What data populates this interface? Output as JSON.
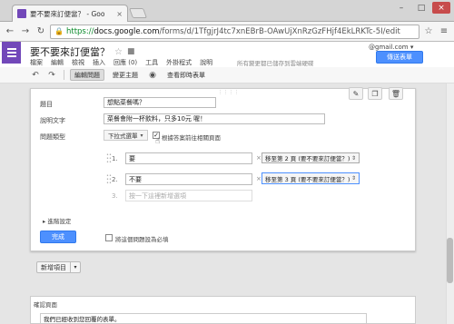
{
  "browser": {
    "tab_title": "要不要來訂便當？ - Goo",
    "tab_close": "×",
    "user": " ",
    "win_min": "–",
    "win_max": "□",
    "win_close": "×",
    "url_scheme": "https://",
    "url_host": "docs.google.com",
    "url_path": "/forms/d/1TfgjrJ4tc7xnEBrB-OAwUjXnRzGzFHjf4EkLRKTc-5I/edit"
  },
  "app": {
    "doc_title": "要不要來訂便當？",
    "account": "@gmail.com ▾",
    "share_label": "傳送表單",
    "saved_status": "所有變更都已儲存到雲端硬碟",
    "menu": [
      "檔案",
      "編輯",
      "檢視",
      "插入",
      "回應 (0)",
      "工具",
      "外掛程式",
      "說明"
    ]
  },
  "toolbar": {
    "edit_questions": "編輯問題",
    "change_theme": "變更主題",
    "view_live": "查看即時表單"
  },
  "question": {
    "title_label": "題目",
    "title_value": "想點菜餐嗎？",
    "help_label": "說明文字",
    "help_value": "菜餐會附一杯飲料，只多10元 喔！",
    "type_label": "問題類型",
    "type_value": "下拉式選單",
    "nav_label": "根據答案前往相關頁面",
    "options": [
      {
        "num": "1.",
        "value": "要",
        "goto": "移至第 2 頁 (要不要來訂便當？)"
      },
      {
        "num": "2.",
        "value": "不要",
        "goto": "移至第 3 頁 (要不要來訂便當？)"
      },
      {
        "num": "3.",
        "placeholder": "按一下這裡新增選項"
      }
    ],
    "advanced": "▸ 進階設定",
    "done": "完成",
    "required_label": "將這個問題設為必填"
  },
  "add_item": "新增項目",
  "confirm": {
    "title": "確認頁面",
    "message": "我們已經收到您回覆的表單。"
  },
  "colors": {
    "brand": "#7248b9",
    "primary": "#4d90fe"
  }
}
